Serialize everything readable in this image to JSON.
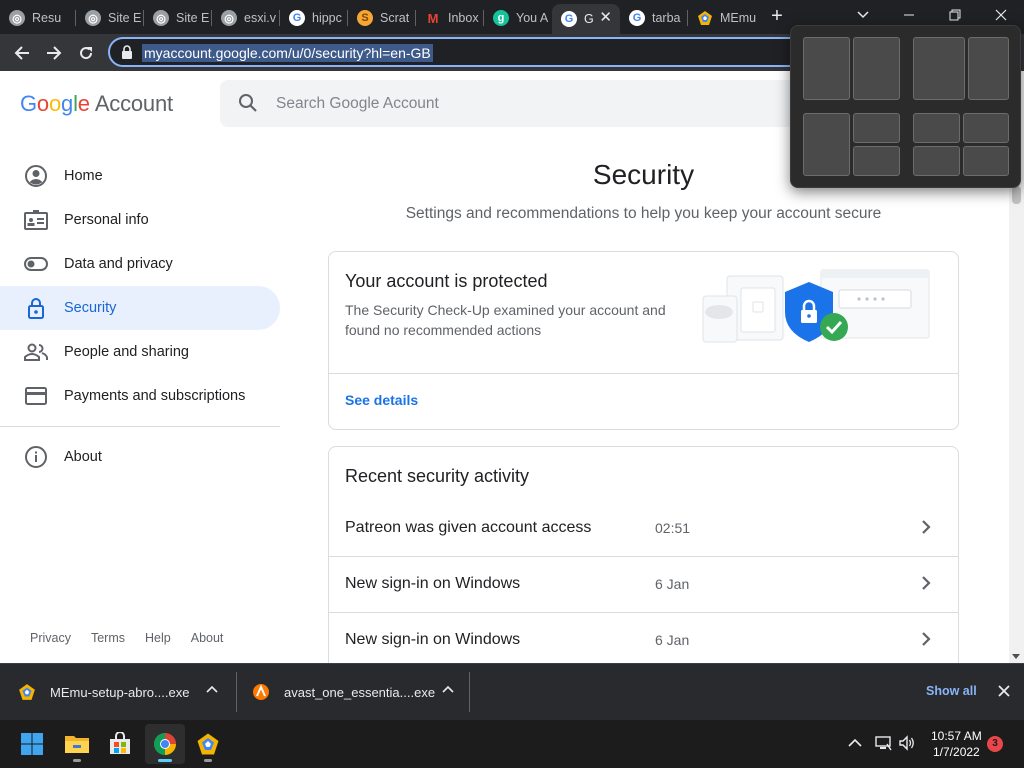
{
  "browser": {
    "tabs": [
      {
        "title": "Resu",
        "icon": "globe-icon"
      },
      {
        "title": "Site E",
        "icon": "globe-icon"
      },
      {
        "title": "Site E",
        "icon": "globe-icon"
      },
      {
        "title": "esxi.v",
        "icon": "globe-icon"
      },
      {
        "title": "hippc",
        "icon": "google-icon"
      },
      {
        "title": "Scrat",
        "icon": "scratch-icon"
      },
      {
        "title": "Inbox",
        "icon": "gmail-icon"
      },
      {
        "title": "You A",
        "icon": "grammarly-icon"
      },
      {
        "title": "G",
        "icon": "google-icon",
        "active": true
      },
      {
        "title": "tarba",
        "icon": "google-icon"
      },
      {
        "title": "MEmu",
        "icon": "memu-icon"
      }
    ],
    "url": "myaccount.google.com/u/0/security?hl=en-GB"
  },
  "header": {
    "logo_letters": [
      "G",
      "o",
      "o",
      "g",
      "l",
      "e"
    ],
    "logo_suffix": "Account",
    "search_placeholder": "Search Google Account"
  },
  "sidebar": {
    "items": [
      {
        "label": "Home",
        "icon": "account-circle-icon"
      },
      {
        "label": "Personal info",
        "icon": "id-card-icon"
      },
      {
        "label": "Data and privacy",
        "icon": "toggle-icon"
      },
      {
        "label": "Security",
        "icon": "lock-icon",
        "active": true
      },
      {
        "label": "People and sharing",
        "icon": "people-icon"
      },
      {
        "label": "Payments and subscriptions",
        "icon": "credit-card-icon"
      }
    ],
    "about": {
      "label": "About",
      "icon": "info-icon"
    },
    "footer": [
      "Privacy",
      "Terms",
      "Help",
      "About"
    ]
  },
  "main": {
    "title": "Security",
    "subtitle": "Settings and recommendations to help you keep your account secure",
    "protected_card": {
      "title": "Your account is protected",
      "description": "The Security Check-Up examined your account and found no recommended actions",
      "link": "See details"
    },
    "activity_card": {
      "title": "Recent security activity",
      "rows": [
        {
          "event": "Patreon was given account access",
          "time": "02:51"
        },
        {
          "event": "New sign-in on Windows",
          "time": "6 Jan"
        },
        {
          "event": "New sign-in on Windows",
          "time": "6 Jan"
        }
      ]
    }
  },
  "downloads": {
    "items": [
      {
        "name": "MEmu-setup-abro....exe",
        "icon": "memu-icon"
      },
      {
        "name": "avast_one_essentia....exe",
        "icon": "avast-icon"
      }
    ],
    "show_all": "Show all"
  },
  "taskbar": {
    "apps": [
      "windows-start-icon",
      "file-explorer-icon",
      "microsoft-store-icon",
      "chrome-icon",
      "memu-icon"
    ],
    "time": "10:57 AM",
    "date": "1/7/2022",
    "notifications": "3"
  },
  "colors": {
    "accent": "#1a73e8",
    "active_nav_bg": "#e8f0fe",
    "chrome_dark": "#202124",
    "shield": "#1a73e8",
    "check": "#34a853"
  }
}
